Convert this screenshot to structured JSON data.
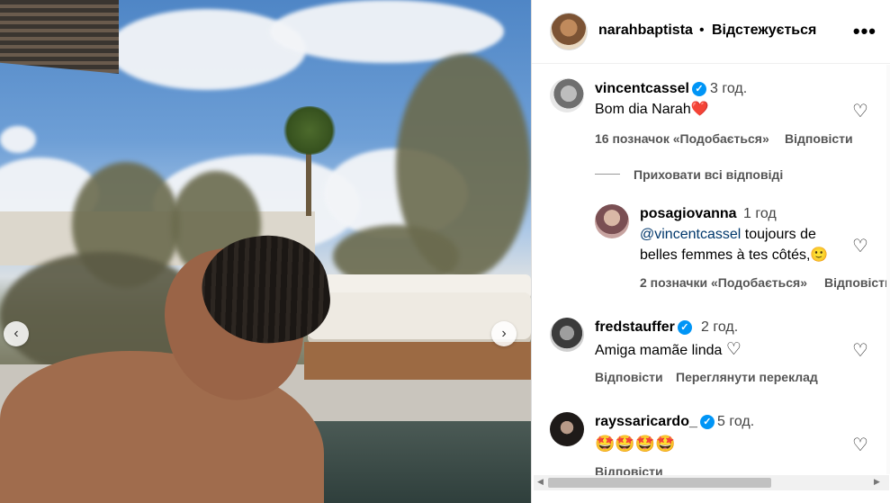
{
  "post": {
    "owner": "narahbaptista",
    "separator": "•",
    "follow_status": "Відстежується",
    "more_icon": "more-horizontal-icon"
  },
  "photo": {
    "prev_icon": "‹",
    "next_icon": "›"
  },
  "comments": [
    {
      "username": "vincentcassel",
      "verified": true,
      "time": "3 год.",
      "text": "Bom dia Narah",
      "emoji": "❤️",
      "likes": "16 позначок «Подобається»",
      "reply": "Відповісти"
    },
    {
      "username": "posagiovanna",
      "verified": false,
      "time": "1 год",
      "mention": "@vincentcassel",
      "text": " toujours de belles femmes à tes côtés,",
      "emoji": "🙂",
      "likes": "2 позначки «Подобається»",
      "reply": "Відповісти"
    },
    {
      "username": "fredstauffer",
      "verified": true,
      "time": "2 год.",
      "text": "Amiga mamãe linda ",
      "emoji": "♡",
      "reply": "Відповісти",
      "translate": "Переглянути переклад"
    },
    {
      "username": "rayssaricardo_",
      "verified": true,
      "time": "5 год.",
      "text": "🤩🤩🤩🤩",
      "reply": "Відповісти"
    }
  ],
  "hide_replies": "Приховати всі відповіді",
  "verified_glyph": "✓",
  "heart_glyph": "♡",
  "colors": {
    "verified": "#0095f6",
    "link": "#00376b",
    "heart_red": "#e0245e"
  }
}
